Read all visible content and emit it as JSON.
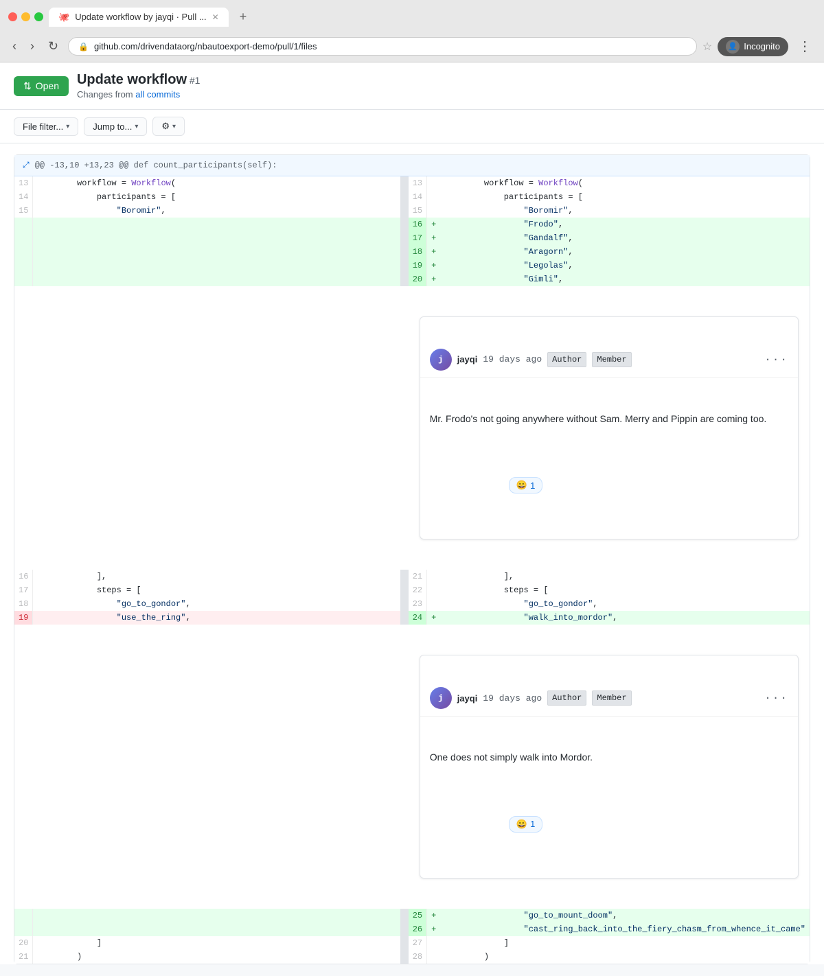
{
  "browser": {
    "tab_title": "Update workflow by jayqi · Pull ...",
    "url": "github.com/drivendataorg/nbautoexport-demo/pull/1/files",
    "incognito_label": "Incognito"
  },
  "pr": {
    "status_label": "Open",
    "title": "Update workflow",
    "number": "#1",
    "subtitle_prefix": "Changes from",
    "subtitle_link": "all commits",
    "file_filter_label": "File filter...",
    "jump_to_label": "Jump to...",
    "settings_label": ""
  },
  "diff_header": {
    "icon": "⤢",
    "hunk": "@@ -13,10 +13,23 @@ def count_participants(self):"
  },
  "comments": [
    {
      "id": "comment1",
      "author": "jayqi",
      "time": "19 days ago",
      "badge1": "Author",
      "badge2": "Member",
      "body": "Mr. Frodo's not going anywhere without Sam. Merry and Pippin are coming too.",
      "reaction_emoji": "😀",
      "reaction_count": "1"
    },
    {
      "id": "comment2",
      "author": "jayqi",
      "time": "19 days ago",
      "badge1": "Author",
      "badge2": "Member",
      "body": "One does not simply walk into Mordor.",
      "reaction_emoji": "😀",
      "reaction_count": "1"
    }
  ],
  "left_lines": [
    {
      "ln": "13",
      "code": "        workflow = Workflow(",
      "type": "normal"
    },
    {
      "ln": "14",
      "code": "            participants = [",
      "type": "normal"
    },
    {
      "ln": "15",
      "code": "                \"Boromir\",",
      "type": "normal"
    },
    {
      "ln": "",
      "code": "",
      "type": "spacer1"
    },
    {
      "ln": "",
      "code": "",
      "type": "spacer2"
    },
    {
      "ln": "",
      "code": "",
      "type": "spacer3"
    },
    {
      "ln": "",
      "code": "",
      "type": "spacer4"
    },
    {
      "ln": "",
      "code": "",
      "type": "spacer5"
    },
    {
      "ln": "16",
      "code": "            ],",
      "type": "normal"
    },
    {
      "ln": "17",
      "code": "            steps = [",
      "type": "normal"
    },
    {
      "ln": "18",
      "code": "                \"go_to_gondor\",",
      "type": "normal"
    },
    {
      "ln": "19",
      "code": "                \"use_the_ring\",",
      "type": "removed"
    },
    {
      "ln": "",
      "code": "",
      "type": "spacer_comment2"
    },
    {
      "ln": "20",
      "code": "            ]",
      "type": "normal"
    },
    {
      "ln": "21",
      "code": "        )",
      "type": "normal"
    }
  ],
  "right_lines": [
    {
      "ln": "13",
      "marker": "",
      "code": "        workflow = Workflow(",
      "type": "normal"
    },
    {
      "ln": "14",
      "marker": "",
      "code": "            participants = [",
      "type": "normal"
    },
    {
      "ln": "15",
      "marker": "",
      "code": "                \"Boromir\",",
      "type": "normal"
    },
    {
      "ln": "16",
      "marker": "+",
      "code": "                \"Frodo\",",
      "type": "added"
    },
    {
      "ln": "17",
      "marker": "+",
      "code": "                \"Gandalf\",",
      "type": "added"
    },
    {
      "ln": "18",
      "marker": "+",
      "code": "                \"Aragorn\",",
      "type": "added"
    },
    {
      "ln": "19",
      "marker": "+",
      "code": "                \"Legolas\",",
      "type": "added"
    },
    {
      "ln": "20",
      "marker": "+",
      "code": "                \"Gimli\",",
      "type": "added"
    },
    {
      "ln": "21",
      "marker": "",
      "code": "            ],",
      "type": "normal"
    },
    {
      "ln": "22",
      "marker": "",
      "code": "            steps = [",
      "type": "normal"
    },
    {
      "ln": "23",
      "marker": "",
      "code": "                \"go_to_gondor\",",
      "type": "normal"
    },
    {
      "ln": "24",
      "marker": "+",
      "code": "                \"walk_into_mordor\",",
      "type": "added"
    },
    {
      "ln": "25",
      "marker": "+",
      "code": "                \"go_to_mount_doom\",",
      "type": "added"
    },
    {
      "ln": "26",
      "marker": "+",
      "code": "                \"cast_ring_back_into_the_fiery_chasm_from_whence_it_came\"",
      "type": "added"
    },
    {
      "ln": "27",
      "marker": "",
      "code": "            ]",
      "type": "normal"
    },
    {
      "ln": "28",
      "marker": "",
      "code": "        )",
      "type": "normal"
    }
  ]
}
